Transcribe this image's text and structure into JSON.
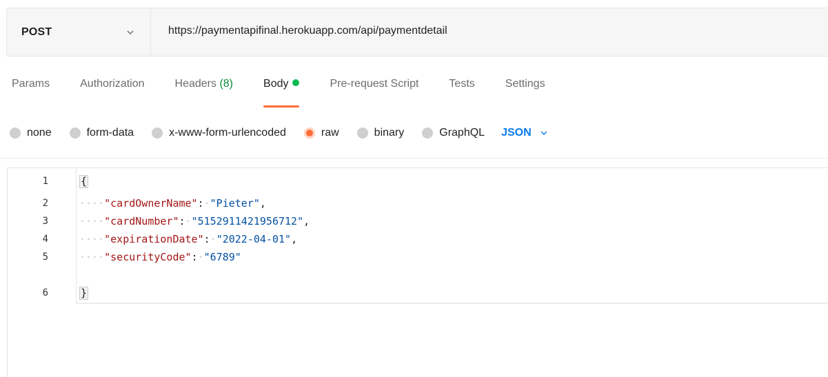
{
  "request": {
    "method": "POST",
    "url": "https://paymentapifinal.herokuapp.com/api/paymentdetail"
  },
  "tabs": [
    {
      "label": "Params"
    },
    {
      "label": "Authorization"
    },
    {
      "label": "Headers",
      "count": "(8)"
    },
    {
      "label": "Body",
      "active": true
    },
    {
      "label": "Pre-request Script"
    },
    {
      "label": "Tests"
    },
    {
      "label": "Settings"
    }
  ],
  "body_types": {
    "options": [
      "none",
      "form-data",
      "x-www-form-urlencoded",
      "raw",
      "binary",
      "GraphQL"
    ],
    "selected": "raw",
    "format": "JSON"
  },
  "editor": {
    "lines": [
      {
        "num": "1",
        "indent": "",
        "key": "",
        "value": "",
        "brace": "{",
        "trail": ""
      },
      {
        "num": "2",
        "indent": "····",
        "key": "\"cardOwnerName\"",
        "value": "\"Pieter\"",
        "brace": "",
        "trail": ","
      },
      {
        "num": "3",
        "indent": "····",
        "key": "\"cardNumber\"",
        "value": "\"5152911421956712\"",
        "brace": "",
        "trail": ","
      },
      {
        "num": "4",
        "indent": "····",
        "key": "\"expirationDate\"",
        "value": "\"2022-04-01\"",
        "brace": "",
        "trail": ","
      },
      {
        "num": "5",
        "indent": "····",
        "key": "\"securityCode\"",
        "value": "\"6789\"",
        "brace": "",
        "trail": ""
      },
      {
        "num": "6",
        "indent": "",
        "key": "",
        "value": "",
        "brace": "}",
        "trail": ""
      }
    ]
  },
  "colors": {
    "accent": "#ff6c37",
    "body_dot": "#0cbb52",
    "headers_count": "#0a8a3a",
    "json_format": "#097bed",
    "json_key": "#a31515",
    "json_string": "#0451a5"
  }
}
